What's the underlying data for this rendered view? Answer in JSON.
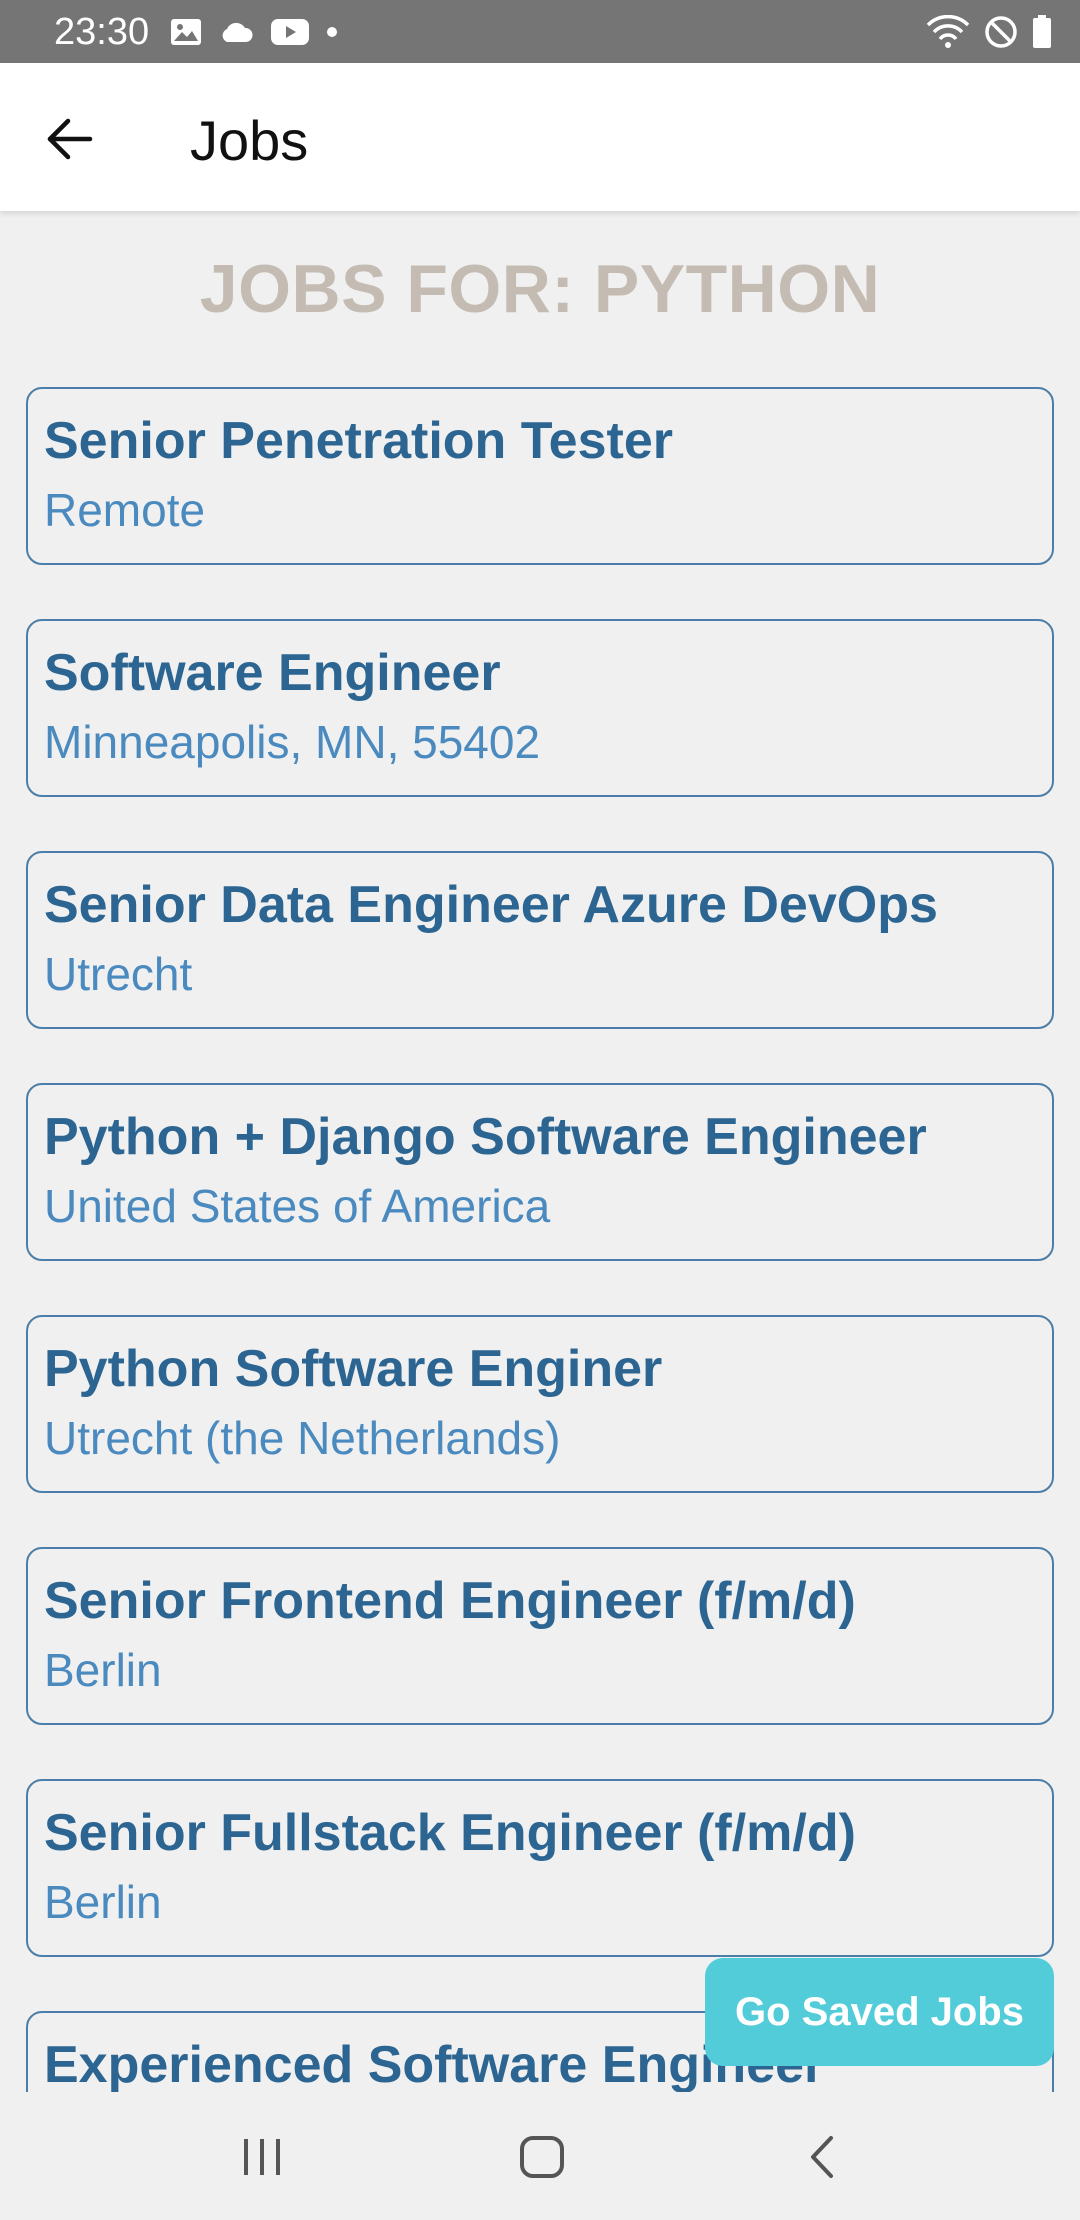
{
  "status_bar": {
    "time": "23:30",
    "left_icons": [
      "image-icon",
      "cloud-icon",
      "youtube-icon",
      "dot-icon"
    ],
    "right_icons": [
      "wifi-icon",
      "do-not-disturb-icon",
      "battery-icon"
    ]
  },
  "app_bar": {
    "back_icon": "arrow-left-icon",
    "title": "Jobs"
  },
  "page": {
    "heading": "JOBS FOR: PYTHON"
  },
  "jobs": [
    {
      "title": "Senior Penetration Tester",
      "location": "Remote"
    },
    {
      "title": "Software Engineer",
      "location": "Minneapolis, MN, 55402"
    },
    {
      "title": "Senior Data Engineer Azure DevOps",
      "location": "Utrecht"
    },
    {
      "title": "Python + Django Software Engineer",
      "location": "United States of America"
    },
    {
      "title": "Python Software Enginer",
      "location": "Utrecht (the Netherlands)"
    },
    {
      "title": "Senior Frontend Engineer (f/m/d)",
      "location": "Berlin"
    },
    {
      "title": "Senior Fullstack Engineer (f/m/d)",
      "location": "Berlin"
    },
    {
      "title": "Experienced Software Engineer",
      "location": ""
    }
  ],
  "floating_button": {
    "label": "Go Saved Jobs"
  },
  "nav_bar": {
    "icons": [
      "recent-apps-icon",
      "home-icon",
      "back-icon"
    ]
  },
  "colors": {
    "status_bar_bg": "#757575",
    "heading": "#c4bcb2",
    "job_title": "#2c6591",
    "job_location": "#4a8abf",
    "card_border": "#4a7ea8",
    "button_bg": "#52ccd9",
    "background": "#f0f0f0"
  }
}
